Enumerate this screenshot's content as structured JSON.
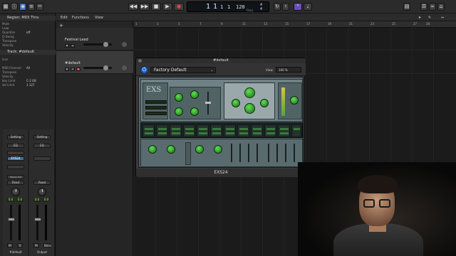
{
  "control_bar": {
    "transport": [
      "◀◀",
      "▶▶",
      "■",
      "▶",
      "●"
    ],
    "lcd": {
      "bars": "1",
      "beats": "1",
      "sub": "1",
      "ticks": "1",
      "tempo": "120",
      "key": "Cmaj",
      "sig_top": "4",
      "sig_bottom": "4"
    }
  },
  "inspector": {
    "region_header": "Region: MIDI Thru",
    "region_rows": [
      {
        "label": "Mute",
        "value": ""
      },
      {
        "label": "Loop",
        "value": ""
      },
      {
        "label": "Quantize",
        "value": "off"
      },
      {
        "label": "Q-Swing",
        "value": ""
      },
      {
        "label": "Transpose",
        "value": ""
      },
      {
        "label": "Velocity",
        "value": ""
      }
    ],
    "track_header": "Track: #default",
    "track_rows": [
      {
        "label": "Icon",
        "value": ""
      },
      {
        "label": "MIDI Channel",
        "value": "All"
      },
      {
        "label": "Transpose",
        "value": ""
      },
      {
        "label": "Velocity",
        "value": ""
      },
      {
        "label": "Key Limit",
        "value": "C-2  G8"
      },
      {
        "label": "Vel Limit",
        "value": "1    127"
      }
    ]
  },
  "strips": [
    {
      "setting": "Setting",
      "eq": "EQ",
      "instrument": "EXS24",
      "midi_fx": "",
      "output": "Stereo Out",
      "read": "Read",
      "vol": "0.0",
      "pan": "0.0",
      "mute": "M",
      "solo": "S",
      "name": "#default"
    },
    {
      "setting": "Setting",
      "eq": "EQ",
      "instrument": "",
      "midi_fx": "",
      "output": "",
      "read": "Read",
      "vol": "0.0",
      "pan": "0.0",
      "mute": "M",
      "solo": "Bnce",
      "name": "Output"
    }
  ],
  "track_area": {
    "menus": [
      "Edit",
      "Functions",
      "View"
    ],
    "add_button": "+",
    "ruler": [
      "1",
      "3",
      "5",
      "7",
      "9",
      "11",
      "13",
      "15",
      "17",
      "19",
      "21",
      "23",
      "25",
      "27",
      "28"
    ],
    "tracks": [
      {
        "name": "Festival Lead",
        "mute": "M",
        "solo": "S",
        "rec": "R",
        "selected": false
      },
      {
        "name": "#default",
        "mute": "M",
        "solo": "S",
        "rec": "R",
        "selected": true
      }
    ]
  },
  "plugin": {
    "window_title": "#default",
    "preset": "Factory Default",
    "view_label": "View:",
    "view_value": "100 %",
    "footer": "EXS24"
  }
}
